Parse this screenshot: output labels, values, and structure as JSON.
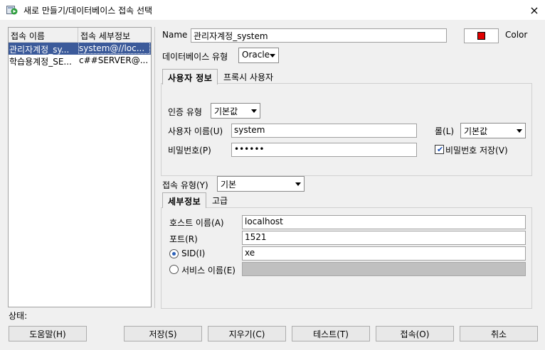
{
  "window": {
    "title": "새로 만들기/데이터베이스 접속 선택",
    "close_icon": "×"
  },
  "connections": {
    "headers": [
      "접속 이름",
      "접속 세부정보"
    ],
    "rows": [
      {
        "name": "관리자계정_sy...",
        "detail": "system@//loc..."
      },
      {
        "name": "학습용계정_SE...",
        "detail": "c##SERVER@..."
      }
    ]
  },
  "form": {
    "name_label": "Name",
    "name_value": "관리자계정_system",
    "color_label": "Color",
    "color_value": "#e00000",
    "db_type_label": "데이터베이스 유형",
    "db_type_value": "Oracle",
    "auth_tabs": [
      "사용자 정보",
      "프록시 사용자"
    ],
    "auth_type_label": "인증 유형",
    "auth_type_value": "기본값",
    "username_label": "사용자 이름(U)",
    "username_value": "system",
    "role_label": "롤(L)",
    "role_value": "기본값",
    "password_label": "비밀번호(P)",
    "password_value": "••••••",
    "save_password_label": "비밀번호 저장(V)",
    "save_password_checked": true,
    "conn_type_label": "접속 유형(Y)",
    "conn_type_value": "기본",
    "detail_tabs": [
      "세부정보",
      "고급"
    ],
    "host_label": "호스트 이름(A)",
    "host_value": "localhost",
    "port_label": "포트(R)",
    "port_value": "1521",
    "sid_label": "SID(I)",
    "sid_value": "xe",
    "service_label": "서비스 이름(E)",
    "service_value": ""
  },
  "status_label": "상태:",
  "buttons": {
    "help": "도움말(H)",
    "save": "저장(S)",
    "clear": "지우기(C)",
    "test": "테스트(T)",
    "connect": "접속(O)",
    "cancel": "취소"
  }
}
